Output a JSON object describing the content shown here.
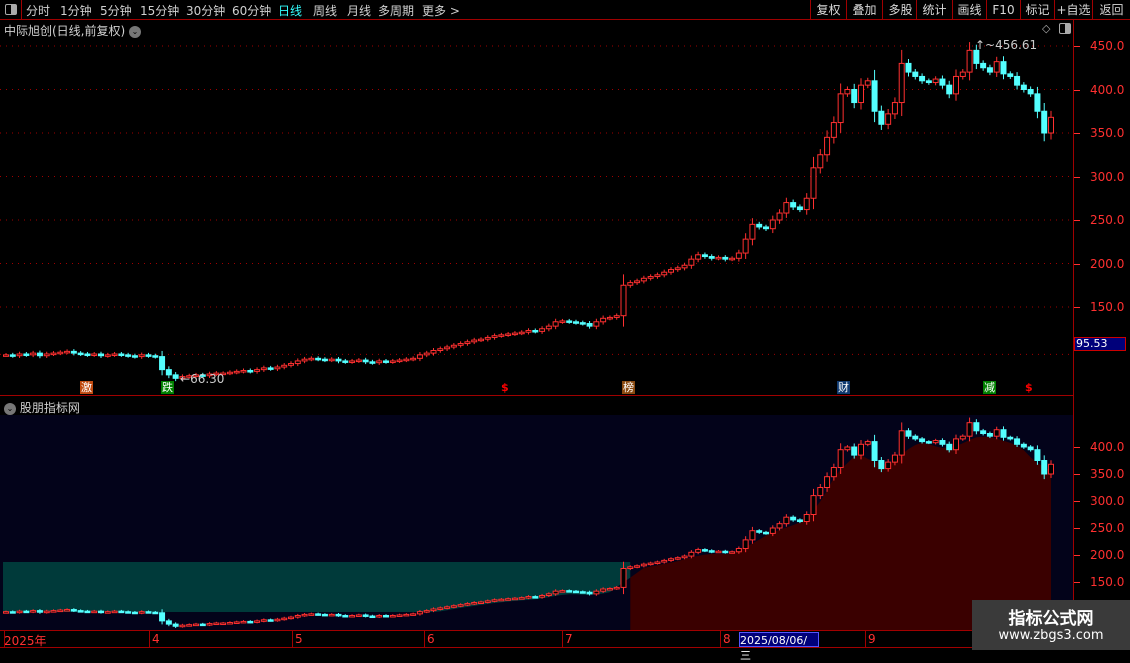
{
  "toolbar": {
    "periods": [
      "分时",
      "1分钟",
      "5分钟",
      "15分钟",
      "30分钟",
      "60分钟",
      "日线",
      "周线",
      "月线",
      "多周期",
      "更多 >"
    ],
    "active_period": "日线",
    "right_buttons": [
      "复权",
      "叠加",
      "多股",
      "统计",
      "画线",
      "F10",
      "标记",
      "+自选",
      "返回"
    ]
  },
  "main": {
    "title": "中际旭创(日线,前复权)",
    "high_label": "456.61",
    "low_label": "66.30",
    "current_price": "95.53",
    "y_ticks": [
      "450.0",
      "400.0",
      "350.0",
      "300.0",
      "250.0",
      "200.0",
      "150.0"
    ],
    "markers": [
      {
        "text": "激",
        "color": "#c04a10"
      },
      {
        "text": "跌",
        "color": "#008000"
      },
      {
        "text": "$",
        "color": "#ff0000"
      },
      {
        "text": "榜",
        "color": "#8a4a10"
      },
      {
        "text": "财",
        "color": "#103a70"
      },
      {
        "text": "减",
        "color": "#008000"
      },
      {
        "text": "$",
        "color": "#ff0000"
      }
    ]
  },
  "indicator": {
    "title": "股朋指标网",
    "y_ticks": [
      "400.0",
      "350.0",
      "300.0",
      "250.0",
      "200.0",
      "150.0"
    ]
  },
  "date_axis": {
    "labels": [
      "2025年",
      "4",
      "5",
      "6",
      "7",
      "8",
      "9"
    ],
    "cursor_date": "2025/08/06/三"
  },
  "watermark": {
    "line1": "指标公式网",
    "line2": "www.zbgs3.com"
  },
  "colors": {
    "up": "#ff3030",
    "down": "#54ffff",
    "grid": "#a00000",
    "teal_band": "#003a3a",
    "red_area": "#3a0000",
    "panel_bg": "#03031a"
  },
  "chart_data": {
    "type": "candlestick",
    "ylim": [
      50,
      470
    ],
    "closes": [
      95,
      94,
      96,
      95,
      97,
      94,
      96,
      97,
      98,
      99,
      97,
      96,
      95,
      96,
      94,
      95,
      96,
      95,
      94,
      93,
      95,
      94,
      93,
      78,
      72,
      68,
      70,
      71,
      72,
      71,
      73,
      74,
      74,
      75,
      76,
      77,
      76,
      78,
      80,
      79,
      81,
      83,
      85,
      88,
      90,
      91,
      90,
      89,
      90,
      88,
      87,
      88,
      89,
      87,
      86,
      88,
      87,
      88,
      89,
      90,
      91,
      95,
      97,
      100,
      102,
      104,
      106,
      108,
      110,
      112,
      113,
      115,
      117,
      118,
      119,
      120,
      121,
      123,
      122,
      125,
      128,
      133,
      134,
      133,
      132,
      131,
      128,
      133,
      137,
      138,
      140,
      175,
      178,
      180,
      183,
      185,
      187,
      190,
      193,
      195,
      198,
      205,
      210,
      208,
      206,
      207,
      205,
      206,
      212,
      228,
      245,
      242,
      240,
      250,
      258,
      270,
      265,
      262,
      275,
      310,
      325,
      345,
      362,
      395,
      400,
      385,
      405,
      410,
      375,
      360,
      372,
      385,
      430,
      420,
      415,
      410,
      408,
      412,
      405,
      395,
      415,
      420,
      445,
      430,
      425,
      420,
      432,
      418,
      415,
      405,
      400,
      395,
      375,
      350,
      368
    ]
  }
}
